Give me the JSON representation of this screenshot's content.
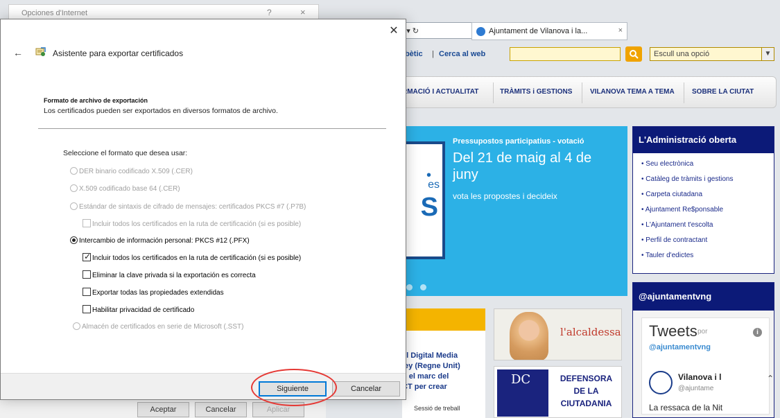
{
  "browser": {
    "address_hint": "⌕ ▾ ↻",
    "tab_title": "Ajuntament de Vilanova i la...",
    "tab_close": "×"
  },
  "site": {
    "link_alfabetic": "alfabètic",
    "link_cerca": "Cerca al web",
    "select_value": "Escull una opció",
    "nav": [
      "RMACIÓ I ACTUALITAT",
      "TRÀMITS i GESTIONS",
      "VILANOVA TEMA A TEMA",
      "SOBRE LA CIUTAT"
    ],
    "hero": {
      "kicker": "Pressupostos participatius - votació",
      "title": "Del 21 de maig al 4 de juny",
      "subtitle": "vota les propostes i decideix",
      "art_text": "es",
      "art_big": "S",
      "art_dot": "•"
    },
    "admin": {
      "title": "L'Administració oberta",
      "items": [
        "Seu electrònica",
        "Catàleg de tràmits i gestions",
        "Carpeta ciutadana",
        "Ajuntament Re$ponsable",
        "L'Ajuntament t'escolta",
        "Perfil de contractant",
        "Tauler d'edictes"
      ]
    },
    "twitter": {
      "title": "@ajuntamentvng",
      "tweets_label": "Tweets",
      "por": "por",
      "handle": "@ajuntamentvng",
      "name": "Vilanova i l",
      "at": "@ajuntame",
      "text": "La ressaca de la Nit",
      "info": "i"
    },
    "news": {
      "lines": [
        "el Digital Media",
        "ley (Regne Unit)",
        "n el marc del",
        "CT per crear"
      ],
      "colon": ":",
      "foot": "Sessió de treball"
    },
    "alcaldessa_label": "l'alcaldessa",
    "defensora": {
      "logo_text": "DC",
      "lines": [
        "DEFENSORA",
        "DE LA",
        "CIUTADANIA"
      ]
    }
  },
  "bg_dialog": {
    "title": "Opciones d'Internet",
    "help": "?",
    "close": "×",
    "buttons": [
      "Aceptar",
      "Cancelar",
      "Aplicar"
    ]
  },
  "wizard": {
    "close": "✕",
    "back": "←",
    "title": "Asistente para exportar certificados",
    "heading": "Formato de archivo de exportación",
    "description": "Los certificados pueden ser exportados en diversos formatos de archivo.",
    "prompt": "Seleccione el formato que desea usar:",
    "options": [
      {
        "label": "DER binario codificado X.509 (.CER)",
        "type": "radio",
        "selected": false,
        "enabled": false
      },
      {
        "label": "X.509 codificado base 64 (.CER)",
        "type": "radio",
        "selected": false,
        "enabled": false
      },
      {
        "label": "Estándar de sintaxis de cifrado de mensajes: certificados PKCS #7 (.P7B)",
        "type": "radio",
        "selected": false,
        "enabled": false
      },
      {
        "label": "Incluir todos los certificados en la ruta de certificación (si es posible)",
        "type": "check",
        "selected": false,
        "enabled": false
      },
      {
        "label": "Intercambio de información personal: PKCS #12 (.PFX)",
        "type": "radio",
        "selected": true,
        "enabled": true
      },
      {
        "label": "Incluir todos los certificados en la ruta de certificación (si es posible)",
        "type": "check",
        "selected": true,
        "enabled": true
      },
      {
        "label": "Eliminar la clave privada si la exportación es correcta",
        "type": "check",
        "selected": false,
        "enabled": true
      },
      {
        "label": "Exportar todas las propiedades extendidas",
        "type": "check",
        "selected": false,
        "enabled": true
      },
      {
        "label": "Habilitar privacidad de certificado",
        "type": "check",
        "selected": false,
        "enabled": true
      },
      {
        "label": "Almacén de certificados en serie de Microsoft (.SST)",
        "type": "radio",
        "selected": false,
        "enabled": false
      }
    ],
    "next_label": "Siguiente",
    "cancel_label": "Cancelar"
  }
}
